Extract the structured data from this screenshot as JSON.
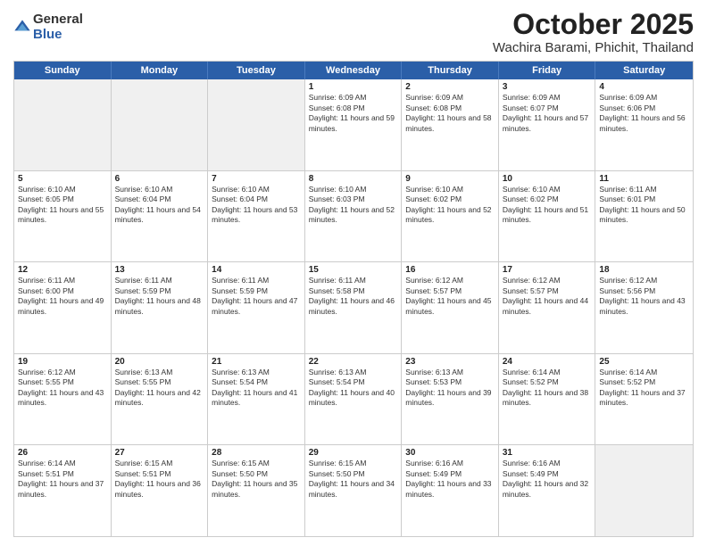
{
  "header": {
    "logo_general": "General",
    "logo_blue": "Blue",
    "month_title": "October 2025",
    "location": "Wachira Barami, Phichit, Thailand"
  },
  "days_of_week": [
    "Sunday",
    "Monday",
    "Tuesday",
    "Wednesday",
    "Thursday",
    "Friday",
    "Saturday"
  ],
  "weeks": [
    [
      {
        "day": "",
        "info": "",
        "shaded": true
      },
      {
        "day": "",
        "info": "",
        "shaded": true
      },
      {
        "day": "",
        "info": "",
        "shaded": true
      },
      {
        "day": "1",
        "info": "Sunrise: 6:09 AM\nSunset: 6:08 PM\nDaylight: 11 hours and 59 minutes.",
        "shaded": false
      },
      {
        "day": "2",
        "info": "Sunrise: 6:09 AM\nSunset: 6:08 PM\nDaylight: 11 hours and 58 minutes.",
        "shaded": false
      },
      {
        "day": "3",
        "info": "Sunrise: 6:09 AM\nSunset: 6:07 PM\nDaylight: 11 hours and 57 minutes.",
        "shaded": false
      },
      {
        "day": "4",
        "info": "Sunrise: 6:09 AM\nSunset: 6:06 PM\nDaylight: 11 hours and 56 minutes.",
        "shaded": false
      }
    ],
    [
      {
        "day": "5",
        "info": "Sunrise: 6:10 AM\nSunset: 6:05 PM\nDaylight: 11 hours and 55 minutes.",
        "shaded": false
      },
      {
        "day": "6",
        "info": "Sunrise: 6:10 AM\nSunset: 6:04 PM\nDaylight: 11 hours and 54 minutes.",
        "shaded": false
      },
      {
        "day": "7",
        "info": "Sunrise: 6:10 AM\nSunset: 6:04 PM\nDaylight: 11 hours and 53 minutes.",
        "shaded": false
      },
      {
        "day": "8",
        "info": "Sunrise: 6:10 AM\nSunset: 6:03 PM\nDaylight: 11 hours and 52 minutes.",
        "shaded": false
      },
      {
        "day": "9",
        "info": "Sunrise: 6:10 AM\nSunset: 6:02 PM\nDaylight: 11 hours and 52 minutes.",
        "shaded": false
      },
      {
        "day": "10",
        "info": "Sunrise: 6:10 AM\nSunset: 6:02 PM\nDaylight: 11 hours and 51 minutes.",
        "shaded": false
      },
      {
        "day": "11",
        "info": "Sunrise: 6:11 AM\nSunset: 6:01 PM\nDaylight: 11 hours and 50 minutes.",
        "shaded": false
      }
    ],
    [
      {
        "day": "12",
        "info": "Sunrise: 6:11 AM\nSunset: 6:00 PM\nDaylight: 11 hours and 49 minutes.",
        "shaded": false
      },
      {
        "day": "13",
        "info": "Sunrise: 6:11 AM\nSunset: 5:59 PM\nDaylight: 11 hours and 48 minutes.",
        "shaded": false
      },
      {
        "day": "14",
        "info": "Sunrise: 6:11 AM\nSunset: 5:59 PM\nDaylight: 11 hours and 47 minutes.",
        "shaded": false
      },
      {
        "day": "15",
        "info": "Sunrise: 6:11 AM\nSunset: 5:58 PM\nDaylight: 11 hours and 46 minutes.",
        "shaded": false
      },
      {
        "day": "16",
        "info": "Sunrise: 6:12 AM\nSunset: 5:57 PM\nDaylight: 11 hours and 45 minutes.",
        "shaded": false
      },
      {
        "day": "17",
        "info": "Sunrise: 6:12 AM\nSunset: 5:57 PM\nDaylight: 11 hours and 44 minutes.",
        "shaded": false
      },
      {
        "day": "18",
        "info": "Sunrise: 6:12 AM\nSunset: 5:56 PM\nDaylight: 11 hours and 43 minutes.",
        "shaded": false
      }
    ],
    [
      {
        "day": "19",
        "info": "Sunrise: 6:12 AM\nSunset: 5:55 PM\nDaylight: 11 hours and 43 minutes.",
        "shaded": false
      },
      {
        "day": "20",
        "info": "Sunrise: 6:13 AM\nSunset: 5:55 PM\nDaylight: 11 hours and 42 minutes.",
        "shaded": false
      },
      {
        "day": "21",
        "info": "Sunrise: 6:13 AM\nSunset: 5:54 PM\nDaylight: 11 hours and 41 minutes.",
        "shaded": false
      },
      {
        "day": "22",
        "info": "Sunrise: 6:13 AM\nSunset: 5:54 PM\nDaylight: 11 hours and 40 minutes.",
        "shaded": false
      },
      {
        "day": "23",
        "info": "Sunrise: 6:13 AM\nSunset: 5:53 PM\nDaylight: 11 hours and 39 minutes.",
        "shaded": false
      },
      {
        "day": "24",
        "info": "Sunrise: 6:14 AM\nSunset: 5:52 PM\nDaylight: 11 hours and 38 minutes.",
        "shaded": false
      },
      {
        "day": "25",
        "info": "Sunrise: 6:14 AM\nSunset: 5:52 PM\nDaylight: 11 hours and 37 minutes.",
        "shaded": false
      }
    ],
    [
      {
        "day": "26",
        "info": "Sunrise: 6:14 AM\nSunset: 5:51 PM\nDaylight: 11 hours and 37 minutes.",
        "shaded": false
      },
      {
        "day": "27",
        "info": "Sunrise: 6:15 AM\nSunset: 5:51 PM\nDaylight: 11 hours and 36 minutes.",
        "shaded": false
      },
      {
        "day": "28",
        "info": "Sunrise: 6:15 AM\nSunset: 5:50 PM\nDaylight: 11 hours and 35 minutes.",
        "shaded": false
      },
      {
        "day": "29",
        "info": "Sunrise: 6:15 AM\nSunset: 5:50 PM\nDaylight: 11 hours and 34 minutes.",
        "shaded": false
      },
      {
        "day": "30",
        "info": "Sunrise: 6:16 AM\nSunset: 5:49 PM\nDaylight: 11 hours and 33 minutes.",
        "shaded": false
      },
      {
        "day": "31",
        "info": "Sunrise: 6:16 AM\nSunset: 5:49 PM\nDaylight: 11 hours and 32 minutes.",
        "shaded": false
      },
      {
        "day": "",
        "info": "",
        "shaded": true
      }
    ]
  ]
}
